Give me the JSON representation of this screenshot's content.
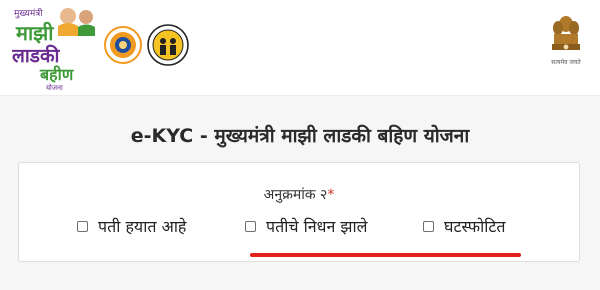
{
  "header": {
    "scheme_logo": {
      "line1": "मुख्यमंत्री",
      "line2": "माझी",
      "line3": "लाडकी",
      "line4": "बहीण",
      "line5": "योजना",
      "icon": "scheme-logo-icon"
    },
    "seal_maharashtra": {
      "icon": "maharashtra-government-seal-icon"
    },
    "seal_department": {
      "icon": "women-child-development-seal-icon"
    },
    "emblem": {
      "caption": "सत्यमेव जयते",
      "icon": "national-emblem-icon"
    }
  },
  "page": {
    "title": "e-KYC - मुख्यमंत्री माझी लाडकी बहिण योजना"
  },
  "form": {
    "field_label": "अनुक्रमांक २",
    "required_mark": "*",
    "options": [
      {
        "label": "पती हयात आहे",
        "checked": false
      },
      {
        "label": "पतीचे निधन झाले",
        "checked": false
      },
      {
        "label": "घटस्फोटित",
        "checked": false
      }
    ]
  },
  "colors": {
    "highlight_underline": "#e3231a",
    "logo_purple": "#6b2c91",
    "logo_green": "#3f9b3a",
    "seal_orange": "#f29a1f"
  }
}
